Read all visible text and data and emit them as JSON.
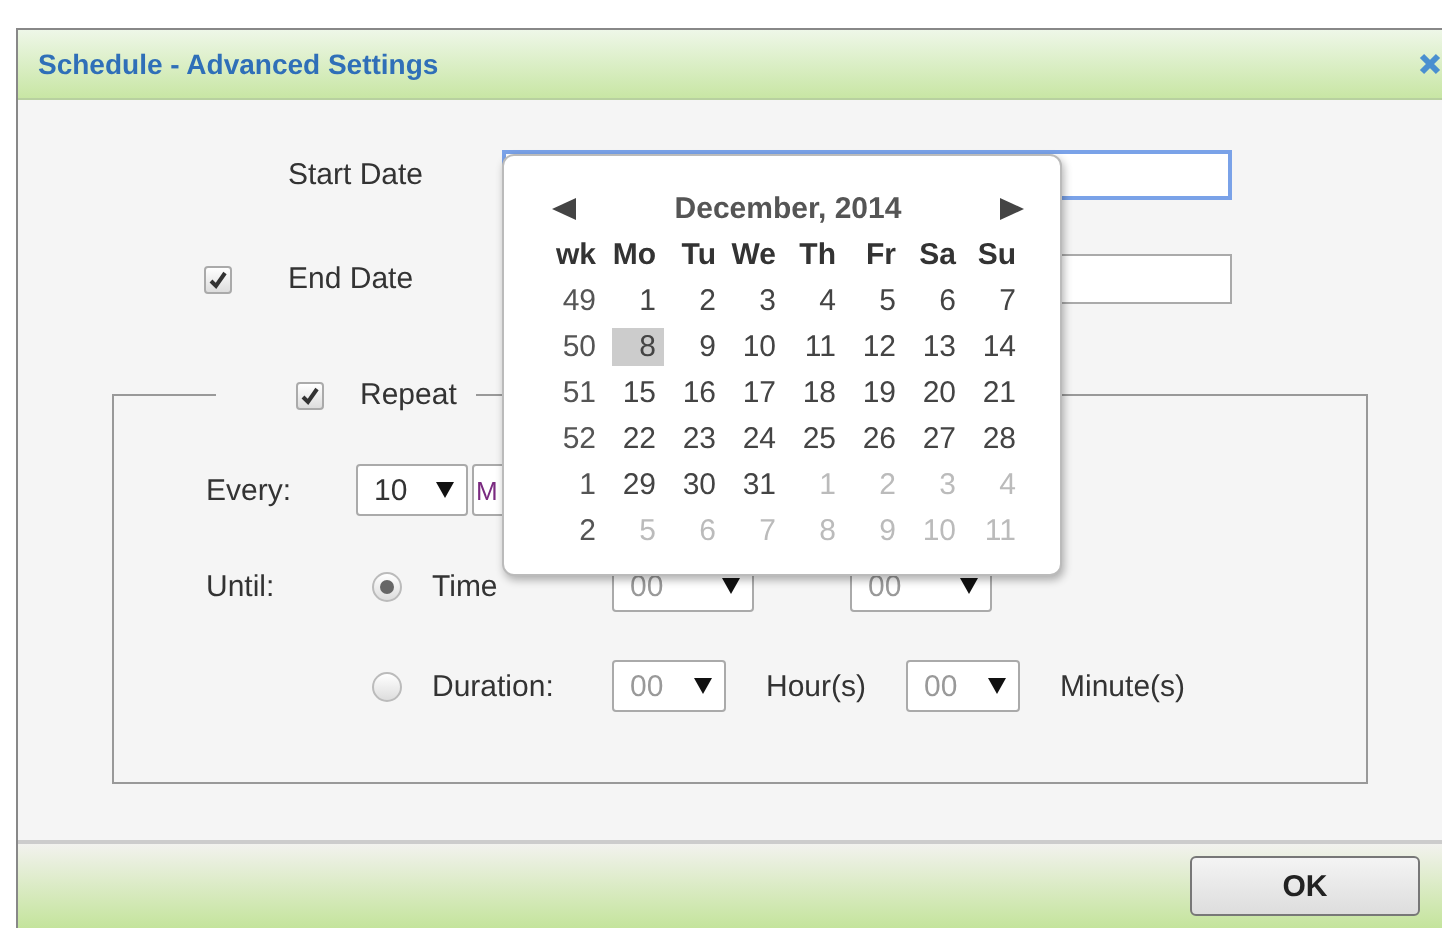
{
  "dialog": {
    "title": "Schedule - Advanced Settings"
  },
  "start_date": {
    "label": "Start Date",
    "focused": true
  },
  "end_date": {
    "label": "End Date",
    "checked": true
  },
  "repeat": {
    "label": "Repeat",
    "checked": true,
    "every": {
      "label": "Every:",
      "value": "10",
      "unit_value": "M"
    },
    "until": {
      "label": "Until:",
      "options": [
        {
          "kind": "time",
          "label": "Time",
          "selected": true,
          "fields": [
            {
              "value": "00"
            },
            {
              "value": "00"
            }
          ]
        },
        {
          "kind": "duration",
          "label": "Duration:",
          "selected": false,
          "fields": [
            {
              "value": "00",
              "unit": "Hour(s)"
            },
            {
              "value": "00",
              "unit": "Minute(s)"
            }
          ]
        }
      ]
    }
  },
  "calendar": {
    "title": "December, 2014",
    "headers": [
      "wk",
      "Mo",
      "Tu",
      "We",
      "Th",
      "Fr",
      "Sa",
      "Su"
    ],
    "weeks": [
      {
        "week": "49",
        "days": [
          {
            "d": "1",
            "other": false,
            "selected": false
          },
          {
            "d": "2",
            "other": false,
            "selected": false
          },
          {
            "d": "3",
            "other": false,
            "selected": false
          },
          {
            "d": "4",
            "other": false,
            "selected": false
          },
          {
            "d": "5",
            "other": false,
            "selected": false
          },
          {
            "d": "6",
            "other": false,
            "selected": false
          },
          {
            "d": "7",
            "other": false,
            "selected": false
          }
        ]
      },
      {
        "week": "50",
        "days": [
          {
            "d": "8",
            "other": false,
            "selected": true
          },
          {
            "d": "9",
            "other": false,
            "selected": false
          },
          {
            "d": "10",
            "other": false,
            "selected": false
          },
          {
            "d": "11",
            "other": false,
            "selected": false
          },
          {
            "d": "12",
            "other": false,
            "selected": false
          },
          {
            "d": "13",
            "other": false,
            "selected": false
          },
          {
            "d": "14",
            "other": false,
            "selected": false
          }
        ]
      },
      {
        "week": "51",
        "days": [
          {
            "d": "15",
            "other": false,
            "selected": false
          },
          {
            "d": "16",
            "other": false,
            "selected": false
          },
          {
            "d": "17",
            "other": false,
            "selected": false
          },
          {
            "d": "18",
            "other": false,
            "selected": false
          },
          {
            "d": "19",
            "other": false,
            "selected": false
          },
          {
            "d": "20",
            "other": false,
            "selected": false
          },
          {
            "d": "21",
            "other": false,
            "selected": false
          }
        ]
      },
      {
        "week": "52",
        "days": [
          {
            "d": "22",
            "other": false,
            "selected": false
          },
          {
            "d": "23",
            "other": false,
            "selected": false
          },
          {
            "d": "24",
            "other": false,
            "selected": false
          },
          {
            "d": "25",
            "other": false,
            "selected": false
          },
          {
            "d": "26",
            "other": false,
            "selected": false
          },
          {
            "d": "27",
            "other": false,
            "selected": false
          },
          {
            "d": "28",
            "other": false,
            "selected": false
          }
        ]
      },
      {
        "week": "1",
        "days": [
          {
            "d": "29",
            "other": false,
            "selected": false
          },
          {
            "d": "30",
            "other": false,
            "selected": false
          },
          {
            "d": "31",
            "other": false,
            "selected": false
          },
          {
            "d": "1",
            "other": true,
            "selected": false
          },
          {
            "d": "2",
            "other": true,
            "selected": false
          },
          {
            "d": "3",
            "other": true,
            "selected": false
          },
          {
            "d": "4",
            "other": true,
            "selected": false
          }
        ]
      },
      {
        "week": "2",
        "days": [
          {
            "d": "5",
            "other": true,
            "selected": false
          },
          {
            "d": "6",
            "other": true,
            "selected": false
          },
          {
            "d": "7",
            "other": true,
            "selected": false
          },
          {
            "d": "8",
            "other": true,
            "selected": false
          },
          {
            "d": "9",
            "other": true,
            "selected": false
          },
          {
            "d": "10",
            "other": true,
            "selected": false
          },
          {
            "d": "11",
            "other": true,
            "selected": false
          }
        ]
      }
    ]
  },
  "buttons": [
    "OK"
  ]
}
